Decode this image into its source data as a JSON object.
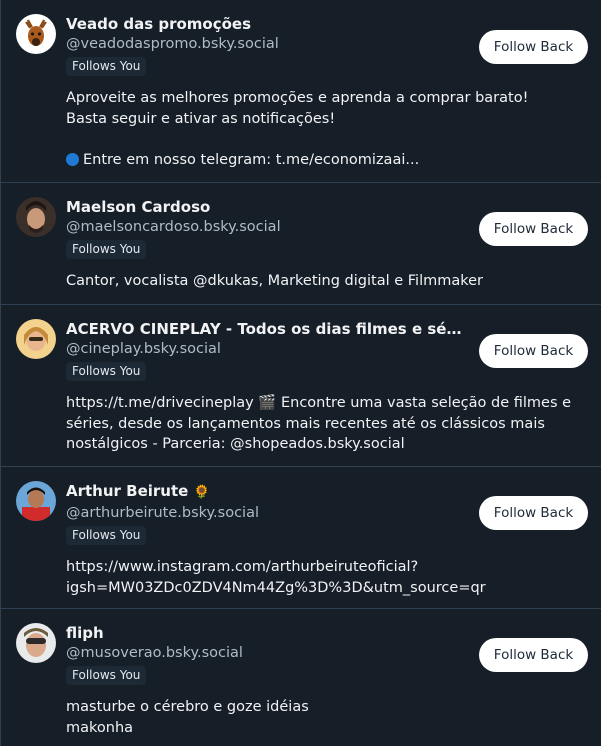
{
  "follow_back_label": "Follow Back",
  "follows_you_label": "Follows You",
  "users": [
    {
      "name": "Veado das promoções",
      "handle": "@veadodaspromo.bsky.social",
      "bio_line1": "Aproveite as melhores promoções e aprenda a comprar barato!\nBasta seguir e ativar as notificações!",
      "bio_line2": "Entre em nosso telegram: t.me/economizaai..."
    },
    {
      "name": "Maelson Cardoso",
      "handle": "@maelsoncardoso.bsky.social",
      "bio": "Cantor, vocalista @dkukas, Marketing digital e Filmmaker"
    },
    {
      "name": "ACERVO CINEPLAY - Todos os dias filmes e séries ...",
      "handle": "@cineplay.bsky.social",
      "bio": "https://t.me/drivecineplay 🎬 Encontre uma vasta seleção de filmes e séries, desde os lançamentos mais recentes até os clássicos mais nostálgicos - Parceria: @shopeados.bsky.social"
    },
    {
      "name": "Arthur Beirute",
      "name_emoji": "🌻",
      "handle": "@arthurbeirute.bsky.social",
      "bio": "https://www.instagram.com/arthurbeiruteoficial?\nigsh=MW03ZDc0ZDV4Nm44Zg%3D%3D&utm_source=qr"
    },
    {
      "name": "fliph",
      "handle": "@musoverao.bsky.social",
      "bio": "masturbe o cérebro e goze idéias\nmakonha"
    }
  ]
}
